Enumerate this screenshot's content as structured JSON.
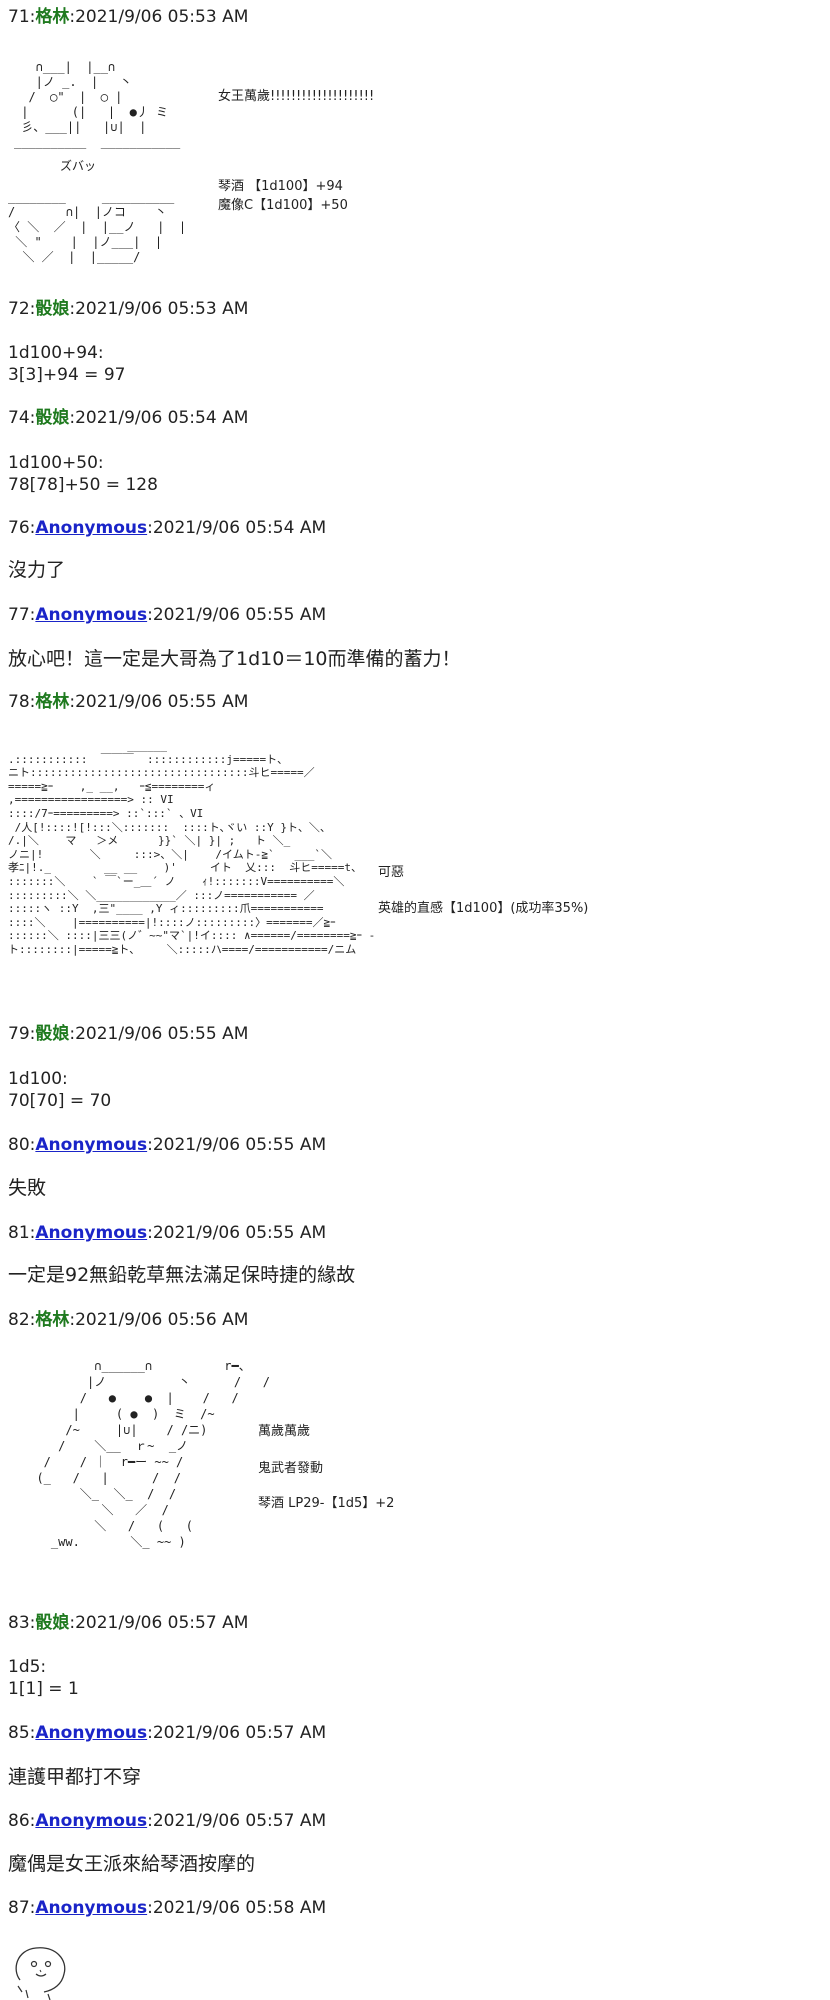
{
  "posts": [
    {
      "num": "71",
      "name": "格林",
      "time": "2021/9/06 05:53 AM"
    },
    {
      "num": "72",
      "name": "骰娘",
      "time": "2021/9/06 05:53 AM",
      "lines": [
        "1d100+94:",
        "3[3]+94 = 97"
      ]
    },
    {
      "num": "74",
      "name": "骰娘",
      "time": "2021/9/06 05:54 AM",
      "lines": [
        "1d100+50:",
        "78[78]+50 = 128"
      ]
    },
    {
      "num": "76",
      "name": "Anonymous",
      "time": "2021/9/06 05:54 AM",
      "text": "沒力了"
    },
    {
      "num": "77",
      "name": "Anonymous",
      "time": "2021/9/06 05:55 AM",
      "text": "放心吧！這一定是大哥為了1d10＝10而準備的蓄力！"
    },
    {
      "num": "78",
      "name": "格林",
      "time": "2021/9/06 05:55 AM"
    },
    {
      "num": "79",
      "name": "骰娘",
      "time": "2021/9/06 05:55 AM",
      "lines": [
        "1d100:",
        "70[70] = 70"
      ]
    },
    {
      "num": "80",
      "name": "Anonymous",
      "time": "2021/9/06 05:55 AM",
      "text": "失敗"
    },
    {
      "num": "81",
      "name": "Anonymous",
      "time": "2021/9/06 05:55 AM",
      "text": "一定是92無鉛乾草無法滿足保時捷的緣故"
    },
    {
      "num": "82",
      "name": "格林",
      "time": "2021/9/06 05:56 AM"
    },
    {
      "num": "83",
      "name": "骰娘",
      "time": "2021/9/06 05:57 AM",
      "lines": [
        "1d5:",
        "1[1] = 1"
      ]
    },
    {
      "num": "85",
      "name": "Anonymous",
      "time": "2021/9/06 05:57 AM",
      "text": "連護甲都打不穿"
    },
    {
      "num": "86",
      "name": "Anonymous",
      "time": "2021/9/06 05:57 AM",
      "text": "魔偶是女王派來給琴酒按摩的"
    },
    {
      "num": "87",
      "name": "Anonymous",
      "time": "2021/9/06 05:58 AM"
    }
  ],
  "aa71": {
    "shout": "女王萬歲!!!!!!!!!!!!!!!!!!!!",
    "sfx": "ズバッ",
    "roll1": "琴酒 【1d100】+94",
    "roll2": "魔像C【1d100】+50"
  },
  "aa78": {
    "line1": "可惡",
    "line2": "英雄的直感【1d100】(成功率35%)"
  },
  "aa82": {
    "line1": "萬歲萬歲",
    "line2": "鬼武者發動",
    "line3": "琴酒 LP29-【1d5】+2"
  },
  "sep": ":"
}
